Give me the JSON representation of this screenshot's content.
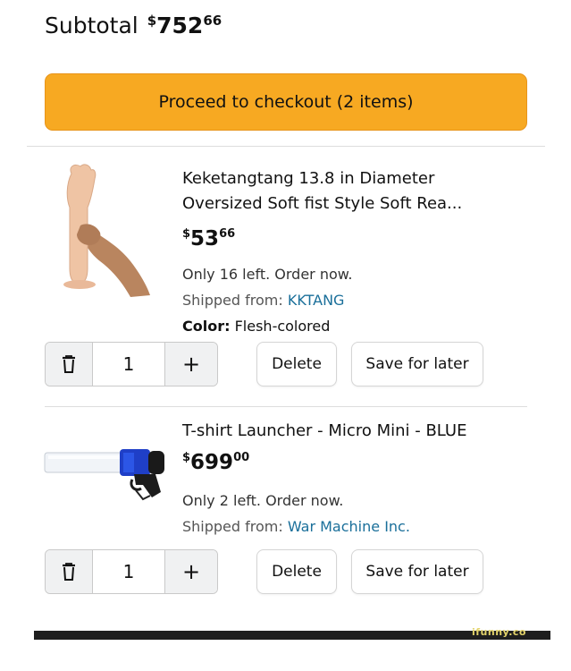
{
  "subtotal": {
    "label": "Subtotal",
    "currency": "$",
    "whole": "752",
    "cents": "66"
  },
  "checkout": {
    "label": "Proceed to checkout (2 items)",
    "color": "#f7a922"
  },
  "items": [
    {
      "title_line1": "Keketangtang 13.8 in Diameter",
      "title_line2": "Oversized Soft fist Style Soft Rea...",
      "price_currency": "$",
      "price_whole": "53",
      "price_cents": "66",
      "stock": "Only 16 left. Order now.",
      "shipped_label": "Shipped from:",
      "seller": "KKTANG",
      "color_label": "Color:",
      "color_value": "Flesh-colored",
      "quantity": "1",
      "delete_label": "Delete",
      "save_label": "Save for later",
      "image_icon": "product-image"
    },
    {
      "title_line1": "T-shirt Launcher - Micro Mini - BLUE",
      "price_currency": "$",
      "price_whole": "699",
      "price_cents": "00",
      "stock": "Only 2 left. Order now.",
      "shipped_label": "Shipped from:",
      "seller": "War Machine Inc.",
      "quantity": "1",
      "delete_label": "Delete",
      "save_label": "Save for later",
      "image_icon": "product-image"
    }
  ],
  "icons": {
    "trash": "trash-icon",
    "plus": "plus-icon"
  },
  "plus_symbol": "+",
  "watermark": "ifunny.co",
  "colors": {
    "seller_link": "#1a6f9a",
    "divider": "#dddddd"
  }
}
